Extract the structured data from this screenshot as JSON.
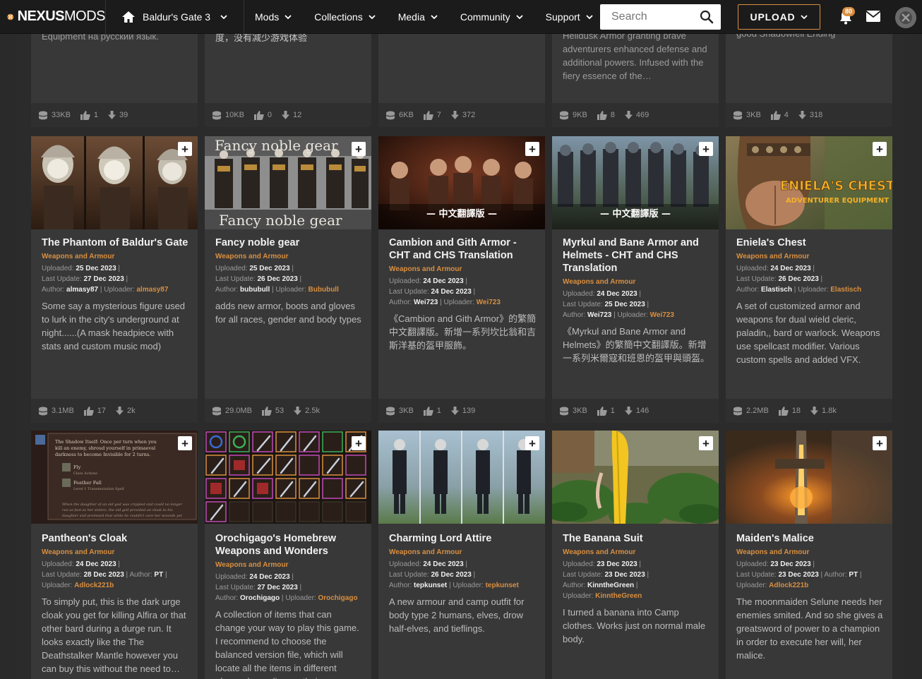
{
  "brand": {
    "name_bold": "NEXUS",
    "name_light": "MODS"
  },
  "game": {
    "label": "Baldur's Gate 3"
  },
  "menu": [
    {
      "label": "Mods"
    },
    {
      "label": "Collections"
    },
    {
      "label": "Media"
    },
    {
      "label": "Community"
    },
    {
      "label": "Support"
    }
  ],
  "search": {
    "placeholder": "Search"
  },
  "upload": {
    "label": "UPLOAD"
  },
  "notifications": {
    "count": "80"
  },
  "colors": {
    "accent": "#d98f40",
    "card": "#383838",
    "nav": "#1b1b1b"
  },
  "top_row": [
    {
      "text": "Equipment на русский язык.",
      "size": "33KB",
      "endorsements": "1",
      "downloads": "39"
    },
    {
      "text": "邻座RPG游戏体验，降低了游玩难度，没有减少游戏体验",
      "size": "10KB",
      "endorsements": "0",
      "downloads": "12"
    },
    {
      "text": "",
      "size": "6KB",
      "endorsements": "7",
      "downloads": "372"
    },
    {
      "text": "Helldusk Armor granting brave adventurers enhanced defense and additional powers. Infused with the fiery essence of the…",
      "size": "9KB",
      "endorsements": "8",
      "downloads": "469"
    },
    {
      "text": "good Shadowfell Ending",
      "size": "3KB",
      "endorsements": "4",
      "downloads": "318"
    }
  ],
  "mods": [
    {
      "title": "The Phantom of Baldur's Gate",
      "category": "Weapons and Armour",
      "uploaded": "25 Dec 2023",
      "updated": "27 Dec 2023",
      "author": "almasy87",
      "uploader": "almasy87",
      "description": "Some say a mysterious figure used to lurk in the city's underground at night......(A mask headpiece with stats and custom music mod)",
      "size": "3.1MB",
      "endorsements": "17",
      "downloads": "2k"
    },
    {
      "title": "Fancy noble gear",
      "category": "Weapons and Armour",
      "uploaded": "25 Dec 2023",
      "updated": "26 Dec 2023",
      "author": "bububull",
      "uploader": "Bububull",
      "description": "adds new armor, boots and gloves for all races, gender and body types",
      "size": "29.0MB",
      "endorsements": "53",
      "downloads": "2.5k",
      "thumb_text_top": "Fancy noble gear",
      "thumb_text_bottom": "Fancy noble gear"
    },
    {
      "title": "Cambion and Gith Armor - CHT and CHS Translation",
      "category": "Weapons and Armour",
      "uploaded": "24 Dec 2023",
      "updated": "24 Dec 2023",
      "author": "Wei723",
      "uploader": "Wei723",
      "description": "《Cambion and Gith Armor》的繁簡中文翻譯版。新增一系列坎比翁和吉斯洋基的盔甲服飾。",
      "size": "3KB",
      "endorsements": "1",
      "downloads": "139",
      "thumb_text": "— 中文翻譯版 —"
    },
    {
      "title": "Myrkul and Bane Armor and Helmets - CHT and CHS Translation",
      "category": "Weapons and Armour",
      "uploaded": "24 Dec 2023",
      "updated": "25 Dec 2023",
      "author": "Wei723",
      "uploader": "Wei723",
      "description": "《Myrkul and Bane Armor and Helmets》的繁簡中文翻譯版。新增一系列米爾寇和班恩的盔甲與頭盔。",
      "size": "3KB",
      "endorsements": "1",
      "downloads": "146",
      "thumb_text": "— 中文翻譯版 —"
    },
    {
      "title": "Eniela's Chest",
      "category": "Weapons and Armour",
      "uploaded": "24 Dec 2023",
      "updated": "26 Dec 2023",
      "author": "Elastisch",
      "uploader": "Elastisch",
      "description": "A set of customized armor and weapons for dual wield cleric, paladin,, bard or warlock. Weapons use spellcast modifier. Various custom spells and added VFX.",
      "size": "2.2MB",
      "endorsements": "18",
      "downloads": "1.8k",
      "thumb_text": "ENIELA'S CHEST",
      "thumb_sub": "ADVENTURER EQUIPMENT"
    },
    {
      "title": "Pantheon's Cloak",
      "category": "Weapons and Armour",
      "uploaded": "24 Dec 2023",
      "updated": "28 Dec 2023",
      "author": "PT",
      "uploader": "Adlock221b",
      "description": "To simply put, this is the dark urge cloak you get for killing Alfira or that other bard during a durge run. It looks exactly like the The Deathstalker Mantle however you can buy this without the need to…",
      "size": "",
      "endorsements": "",
      "downloads": "",
      "thumb_lines": [
        "The Shadow Itself: Once per turn when you",
        "kill an enemy, shroud yourself in primaeval",
        "darkness to become Invisible for 2 turns.",
        "Fly",
        "Class Actions",
        "Feather Fall",
        "Level 1 Transmutation Spell",
        "When the daughter of an old god was crippled and could no longer",
        "run as fast as her sisters, the old god provided an cloak to his",
        "daughter and promised that while he couldn't cure her wounds yet"
      ]
    },
    {
      "title": "Orochigago's Homebrew Weapons and Wonders",
      "category": "Weapons and Armour",
      "uploaded": "24 Dec 2023",
      "updated": "27 Dec 2023",
      "author": "Orochigago",
      "uploader": "Orochigago",
      "description": "A collection of items that can change your way to play this game. I recommend to choose the balanced version file, which will locate all the items in different places depending on their…",
      "size": "",
      "endorsements": "",
      "downloads": ""
    },
    {
      "title": "Charming Lord Attire",
      "category": "Weapons and Armour",
      "uploaded": "24 Dec 2023",
      "updated": "26 Dec 2023",
      "author": "tepkunset",
      "uploader": "tepkunset",
      "description": "A new armour and camp outfit for body type 2 humans, elves, drow half-elves, and tieflings.",
      "size": "",
      "endorsements": "",
      "downloads": ""
    },
    {
      "title": "The Banana Suit",
      "category": "Weapons and Armour",
      "uploaded": "23 Dec 2023",
      "updated": "23 Dec 2023",
      "author": "KinntheGreen",
      "uploader": "KinntheGreen",
      "description": "I turned a banana into Camp clothes. Works just on normal male body.",
      "size": "",
      "endorsements": "",
      "downloads": ""
    },
    {
      "title": "Maiden's Malice",
      "category": "Weapons and Armour",
      "uploaded": "23 Dec 2023",
      "updated": "23 Dec 2023",
      "author": "PT",
      "uploader": "Adlock221b",
      "description": "The moonmaiden Selune needs her enemies smited. And so she gives a greatsword of power to a champion in order to execute her will, her malice.",
      "size": "",
      "endorsements": "",
      "downloads": ""
    }
  ],
  "labels": {
    "uploaded": "Uploaded:",
    "updated": "Last Update:",
    "author": "Author:",
    "uploader": "Uploader:"
  }
}
